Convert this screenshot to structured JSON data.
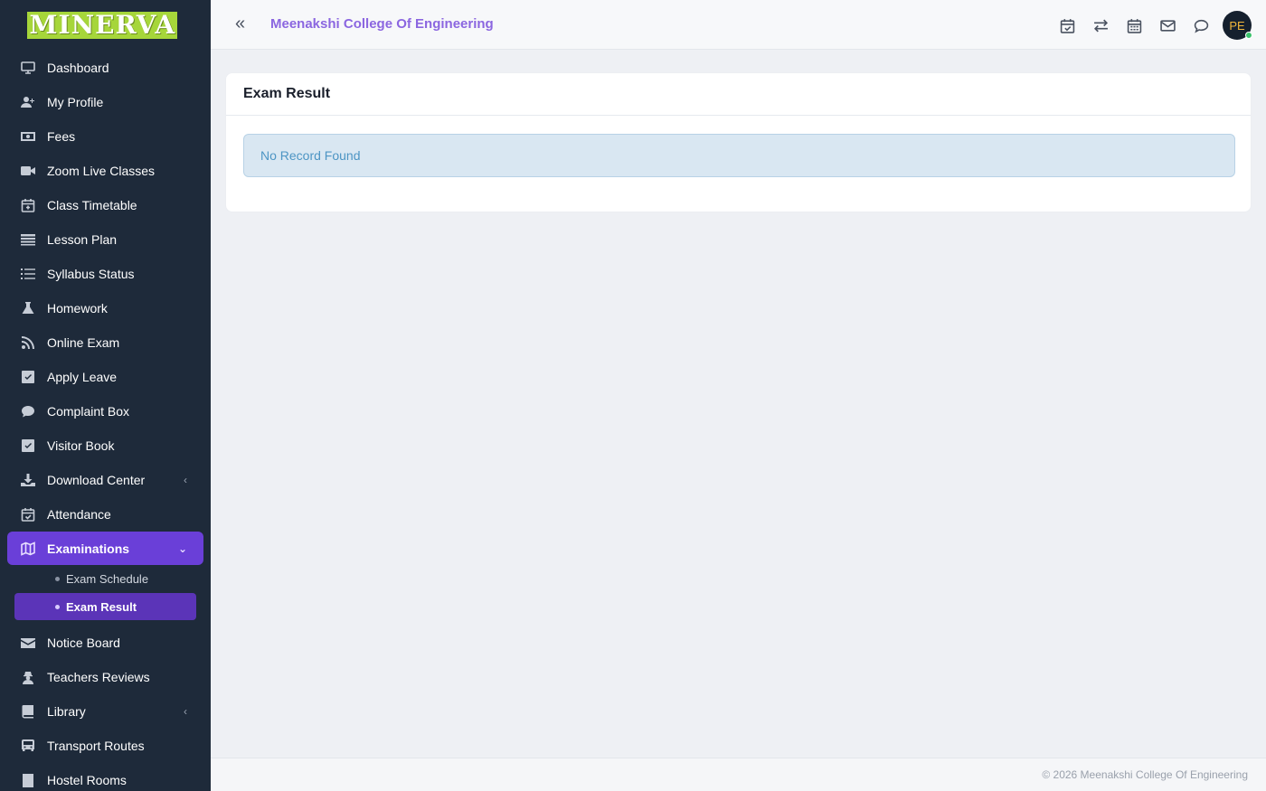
{
  "app": {
    "logo_text": "MINERVA",
    "college_name": "Meenakshi College Of Engineering",
    "user_initials": "PE"
  },
  "sidebar": {
    "items": [
      {
        "label": "Dashboard",
        "icon": "monitor-icon"
      },
      {
        "label": "My Profile",
        "icon": "user-plus-icon"
      },
      {
        "label": "Fees",
        "icon": "money-icon"
      },
      {
        "label": "Zoom Live Classes",
        "icon": "video-icon"
      },
      {
        "label": "Class Timetable",
        "icon": "calendar-plus-icon"
      },
      {
        "label": "Lesson Plan",
        "icon": "list-alt-icon"
      },
      {
        "label": "Syllabus Status",
        "icon": "list-icon"
      },
      {
        "label": "Homework",
        "icon": "flask-icon"
      },
      {
        "label": "Online Exam",
        "icon": "rss-icon"
      },
      {
        "label": "Apply Leave",
        "icon": "check-square-icon"
      },
      {
        "label": "Complaint Box",
        "icon": "comment-icon"
      },
      {
        "label": "Visitor Book",
        "icon": "check-square-icon"
      },
      {
        "label": "Download Center",
        "icon": "download-icon",
        "chevron": "‹"
      },
      {
        "label": "Attendance",
        "icon": "calendar-check-icon"
      },
      {
        "label": "Examinations",
        "icon": "map-icon",
        "chevron": "⌄",
        "active": true,
        "children": [
          {
            "label": "Exam Schedule"
          },
          {
            "label": "Exam Result",
            "active": true
          }
        ]
      },
      {
        "label": "Notice Board",
        "icon": "envelope-icon"
      },
      {
        "label": "Teachers Reviews",
        "icon": "user-secret-icon"
      },
      {
        "label": "Library",
        "icon": "book-icon",
        "chevron": "‹"
      },
      {
        "label": "Transport Routes",
        "icon": "bus-icon"
      },
      {
        "label": "Hostel Rooms",
        "icon": "building-icon"
      }
    ]
  },
  "header": {
    "collapse_icon": "«",
    "icons": [
      "calendar-check-icon",
      "exchange-icon",
      "calendar-icon",
      "envelope-icon",
      "comment-icon"
    ]
  },
  "main": {
    "card_title": "Exam Result",
    "alert_text": "No Record Found"
  },
  "footer": {
    "text": "© 2026 Meenakshi College Of Engineering"
  },
  "colors": {
    "sidebar_bg": "#1e2a3a",
    "active_item": "#6a3fd8",
    "active_subitem": "#5b34b8",
    "brand_text": "#8b66e0",
    "logo_bg": "#a6d63a",
    "alert_bg": "#d9e7f2",
    "alert_text": "#4d95c4"
  }
}
